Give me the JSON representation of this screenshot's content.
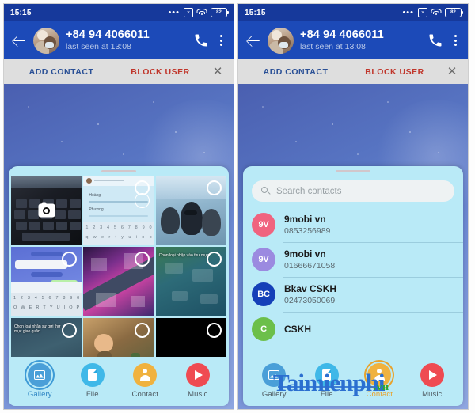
{
  "status_bar": {
    "time": "15:15",
    "icons": [
      "more-dots",
      "screenshot-icon",
      "wifi-icon",
      "battery-icon"
    ],
    "battery_level": "82"
  },
  "app_bar": {
    "back_icon": "back-arrow-icon",
    "avatar": "contact-avatar",
    "title": "+84 94 4066011",
    "subtitle": "last seen at 13:08",
    "call_icon": "phone-icon",
    "menu_icon": "overflow-menu-icon"
  },
  "action_bar": {
    "add_contact": "ADD CONTACT",
    "block_user": "BLOCK USER",
    "close_icon": "close-icon"
  },
  "colors": {
    "status_bar": "#16399b",
    "app_bar": "#1c4ab8",
    "action_bar": "#dedede",
    "add_contact": "#2a5096",
    "block_user": "#c0362b",
    "sheet": "#b9eaf7",
    "accent_blue": "#2f86c4",
    "accent_orange": "#e8a22c"
  },
  "left_panel": {
    "sheet_tab": "gallery",
    "gallery": {
      "camera_tile": "camera-tile",
      "tiles": [
        {
          "name": "keyboard-photo",
          "selected": false,
          "caption": ""
        },
        {
          "name": "chat-screenshot",
          "selected": false,
          "caption": ""
        },
        {
          "name": "sea-photo",
          "selected": false,
          "caption": ""
        },
        {
          "name": "message-screenshot",
          "selected": false,
          "caption": ""
        },
        {
          "name": "game-screenshot-neon",
          "selected": false,
          "caption": ""
        },
        {
          "name": "game-screenshot-base",
          "selected": false,
          "caption": "Chọn loại nhập vào thư mục"
        },
        {
          "name": "game-screenshot-dark",
          "selected": false,
          "caption": "Chọn loại nhân sự gửi thư mục giao quân"
        },
        {
          "name": "game-screenshot-character",
          "selected": false,
          "caption": ""
        },
        {
          "name": "black-tile",
          "selected": false,
          "caption": ""
        }
      ]
    },
    "nav": [
      {
        "label": "Gallery",
        "icon": "gallery-icon",
        "color": "#4a9fd8",
        "active": true
      },
      {
        "label": "File",
        "icon": "file-icon",
        "color": "#3fb8e8",
        "active": false
      },
      {
        "label": "Contact",
        "icon": "contact-icon",
        "color": "#f0b23f",
        "active": false
      },
      {
        "label": "Music",
        "icon": "music-icon",
        "color": "#ef4b52",
        "active": false
      }
    ]
  },
  "right_panel": {
    "sheet_tab": "contact",
    "search": {
      "icon": "search-icon",
      "placeholder": "Search contacts",
      "value": ""
    },
    "contacts": [
      {
        "initials": "9V",
        "name": "9mobi vn",
        "number": "0853256989",
        "color": "#f0637f"
      },
      {
        "initials": "9V",
        "name": "9mobi vn",
        "number": "01666671058",
        "color": "#9b8ae0"
      },
      {
        "initials": "BC",
        "name": "Bkav CSKH",
        "number": "02473050069",
        "color": "#1540b8"
      },
      {
        "initials": "C",
        "name": "CSKH",
        "number": "",
        "color": "#6cbf4a"
      }
    ],
    "nav": [
      {
        "label": "Gallery",
        "icon": "gallery-icon",
        "color": "#4a9fd8",
        "active": false
      },
      {
        "label": "File",
        "icon": "file-icon",
        "color": "#3fb8e8",
        "active": false
      },
      {
        "label": "Contact",
        "icon": "contact-icon",
        "color": "#f0b23f",
        "active": true
      },
      {
        "label": "Music",
        "icon": "music-icon",
        "color": "#ef4b52",
        "active": false
      }
    ],
    "watermark": {
      "main": "Taimienphi",
      "suffix": ".vn"
    }
  }
}
